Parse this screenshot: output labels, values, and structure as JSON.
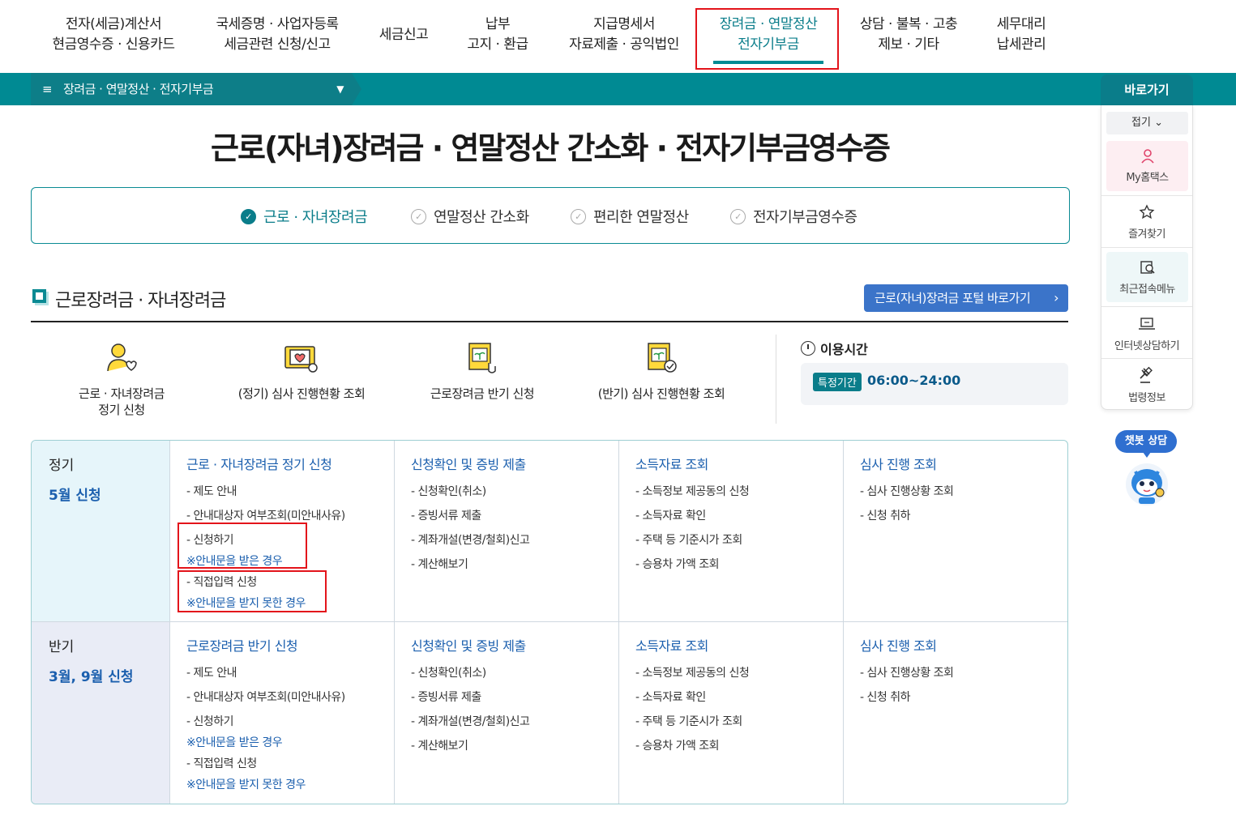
{
  "topnav": [
    {
      "line1": "전자(세금)계산서",
      "line2": "현금영수증 · 신용카드"
    },
    {
      "line1": "국세증명 · 사업자등록",
      "line2": "세금관련 신청/신고"
    },
    {
      "line1": "세금신고",
      "line2": ""
    },
    {
      "line1": "납부",
      "line2": "고지 · 환급"
    },
    {
      "line1": "지급명세서",
      "line2": "자료제출 · 공익법인"
    },
    {
      "line1": "장려금 · 연말정산",
      "line2": "전자기부금"
    },
    {
      "line1": "상담 · 불복 · 고충",
      "line2": "제보 · 기타"
    },
    {
      "line1": "세무대리",
      "line2": "납세관리"
    }
  ],
  "breadcrumb": {
    "label": "장려금 · 연말정산 · 전자기부금",
    "menu_icon": "≡",
    "chevron": "⌄"
  },
  "page_title": "근로(자녀)장려금 · 연말정산 간소화 · 전자기부금영수증",
  "tabs": [
    {
      "label": "근로 · 자녀장려금",
      "active": true
    },
    {
      "label": "연말정산 간소화",
      "active": false
    },
    {
      "label": "편리한 연말정산",
      "active": false
    },
    {
      "label": "전자기부금영수증",
      "active": false
    }
  ],
  "section": {
    "title": "근로장려금 · 자녀장려금",
    "portal_button": "근로(자녀)장려금 포털 바로가기",
    "portal_arrow": "›"
  },
  "quick_icons": [
    {
      "line1": "근로 · 자녀장려금",
      "line2": "정기 신청"
    },
    {
      "line1": "(정기) 심사 진행현황 조회",
      "line2": ""
    },
    {
      "line1": "근로장려금 반기 신청",
      "line2": ""
    },
    {
      "line1": "(반기) 심사 진행현황 조회",
      "line2": ""
    }
  ],
  "usage_time": {
    "title": "이용시간",
    "badge": "특정기간",
    "hours": "06:00~24:00"
  },
  "grid": {
    "rows": [
      {
        "title": "정기",
        "subtitle": "5월 신청",
        "columns": [
          {
            "title": "근로 · 자녀장려금 정기 신청",
            "items": [
              "- 제도 안내",
              "- 안내대상자 여부조회(미안내사유)",
              "- 신청하기",
              "※안내문을 받은 경우",
              "- 직접입력 신청",
              "※안내문을 받지 못한 경우"
            ]
          },
          {
            "title": "신청확인 및 증빙 제출",
            "items": [
              "- 신청확인(취소)",
              "- 증빙서류 제출",
              "- 계좌개설(변경/철회)신고",
              "- 계산해보기"
            ]
          },
          {
            "title": "소득자료 조회",
            "items": [
              "- 소득정보 제공동의 신청",
              "- 소득자료 확인",
              "- 주택 등 기준시가 조회",
              "- 승용차 가액 조회"
            ]
          },
          {
            "title": "심사 진행 조회",
            "items": [
              "- 심사 진행상황 조회",
              "- 신청 취하"
            ]
          }
        ]
      },
      {
        "title": "반기",
        "subtitle": "3월, 9월 신청",
        "columns": [
          {
            "title": "근로장려금 반기 신청",
            "items": [
              "- 제도 안내",
              "- 안내대상자 여부조회(미안내사유)",
              "- 신청하기",
              "※안내문을 받은 경우",
              "- 직접입력 신청",
              "※안내문을 받지 못한 경우"
            ]
          },
          {
            "title": "신청확인 및 증빙 제출",
            "items": [
              "- 신청확인(취소)",
              "- 증빙서류 제출",
              "- 계좌개설(변경/철회)신고",
              "- 계산해보기"
            ]
          },
          {
            "title": "소득자료 조회",
            "items": [
              "- 소득정보 제공동의 신청",
              "- 소득자료 확인",
              "- 주택 등 기준시가 조회",
              "- 승용차 가액 조회"
            ]
          },
          {
            "title": "심사 진행 조회",
            "items": [
              "- 심사 진행상황 조회",
              "- 신청 취하"
            ]
          }
        ]
      }
    ]
  },
  "right_panel": {
    "title": "바로가기",
    "fold": "접기",
    "fold_icon": "⌄",
    "items": [
      {
        "label": "My홈택스",
        "icon": "user-icon"
      },
      {
        "label": "즐겨찾기",
        "icon": "star-icon"
      },
      {
        "label": "최근접속메뉴",
        "icon": "recent-search-icon"
      },
      {
        "label": "인터넷상담하기",
        "icon": "laptop-icon"
      },
      {
        "label": "법령정보",
        "icon": "gavel-icon"
      }
    ]
  },
  "chatbot": {
    "label": "챗봇 상담"
  },
  "colors": {
    "teal": "#008a93",
    "blue": "#1b5fae",
    "portal_button": "#3b74c9",
    "highlight_red": "#e3141b"
  }
}
